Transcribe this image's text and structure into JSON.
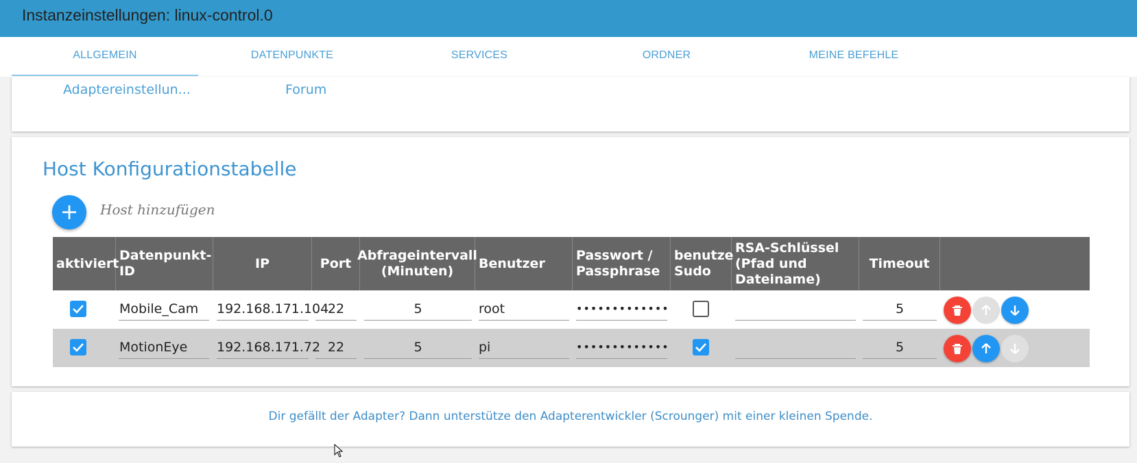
{
  "header": {
    "title": "Instanzeinstellungen: linux-control.0",
    "color": "#3399cc"
  },
  "tabs": [
    {
      "label": "ALLGEMEIN",
      "active": true
    },
    {
      "label": "DATENPUNKTE",
      "active": false
    },
    {
      "label": "SERVICES",
      "active": false
    },
    {
      "label": "ORDNER",
      "active": false
    },
    {
      "label": "MEINE BEFEHLE",
      "active": false
    }
  ],
  "links": {
    "adapter_settings": "Adaptereinstellun...",
    "forum": "Forum"
  },
  "section": {
    "title": "Host Konfigurationstabelle",
    "add_label": "Host hinzufügen",
    "add_icon": "plus-icon"
  },
  "table": {
    "headers": {
      "aktiviert": "aktiviert",
      "id_1": "Datenpunkt-",
      "id_2": "ID",
      "ip": "IP",
      "port": "Port",
      "interval_1": "Abfrageintervall",
      "interval_2": "(Minuten)",
      "user": "Benutzer",
      "pw_1": "Passwort /",
      "pw_2": "Passphrase",
      "sudo_1": "benutze",
      "sudo_2": "Sudo",
      "rsa_1": "RSA-Schlüssel",
      "rsa_2": "(Pfad und",
      "rsa_3": "Dateiname)",
      "timeout": "Timeout"
    },
    "rows": [
      {
        "aktiviert": true,
        "id": "Mobile_Cam",
        "ip": "192.168.171.104",
        "port": "22",
        "interval": "5",
        "user": "root",
        "password": "•••••••••••••",
        "sudo": false,
        "rsa": "",
        "timeout": "5",
        "up_enabled": false,
        "down_enabled": true
      },
      {
        "aktiviert": true,
        "id": "MotionEye",
        "ip": "192.168.171.72",
        "port": "22",
        "interval": "5",
        "user": "pi",
        "password": "•••••••••••••",
        "sudo": true,
        "rsa": "",
        "timeout": "5",
        "up_enabled": true,
        "down_enabled": false
      }
    ]
  },
  "footer": {
    "donate": "Dir gefällt der Adapter? Dann unterstütze den Adapterentwickler (Scrounger) mit einer kleinen Spende."
  },
  "colors": {
    "accent": "#2196f3",
    "delete": "#f44336",
    "header_row": "#666666",
    "link": "#4a9fd6"
  }
}
